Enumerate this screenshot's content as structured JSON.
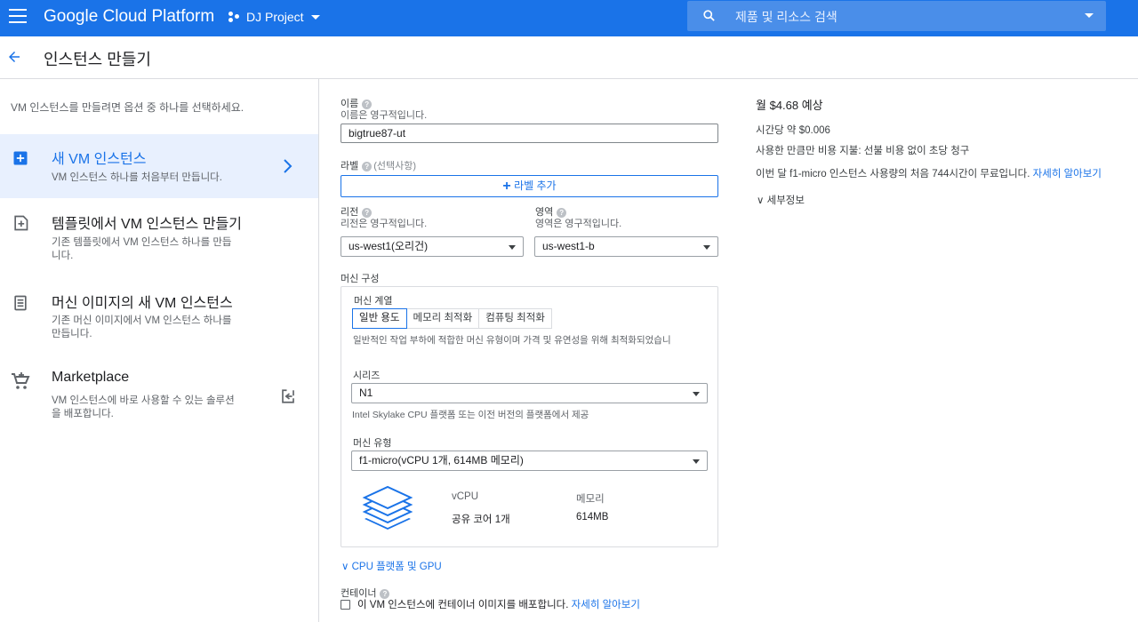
{
  "header": {
    "brand": "Google Cloud Platform",
    "project": "DJ Project",
    "search_placeholder": "제품 및 리소스 검색"
  },
  "title": "인스턴스 만들기",
  "left": {
    "intro": "VM 인스턴스를 만들려면 옵션 중 하나를 선택하세요.",
    "options": [
      {
        "title": "새 VM 인스턴스",
        "desc": "VM 인스턴스 하나를 처음부터 만듭니다.",
        "icon": "add-box-icon"
      },
      {
        "title": "템플릿에서 VM 인스턴스 만들기",
        "desc1": "기존 템플릿에서 VM 인스턴스 하나를 만듭",
        "desc2": "니다.",
        "icon": "template-icon"
      },
      {
        "title": "머신 이미지의 새 VM 인스턴스",
        "desc1": "기존 머신 이미지에서 VM 인스턴스 하나를",
        "desc2": "만듭니다.",
        "icon": "machine-image-icon"
      },
      {
        "title": "Marketplace",
        "desc1": "VM 인스턴스에 바로 사용할 수 있는 솔루션",
        "desc2": "을 배포합니다.",
        "icon": "cart-icon"
      }
    ]
  },
  "form": {
    "name_label": "이름",
    "name_sub": "이름은 영구적입니다.",
    "name_value": "bigtrue87-ut",
    "label_label": "라벨",
    "label_optional": "(선택사항)",
    "add_label_button": "라벨 추가",
    "region_label": "리전",
    "region_sub": "리전은 영구적입니다.",
    "region_value": "us-west1(오리건)",
    "zone_label": "영역",
    "zone_sub": "영역은 영구적입니다.",
    "zone_value": "us-west1-b",
    "machine_config_label": "머신 구성",
    "machine_family_label": "머신 계열",
    "tabs": [
      "일반 용도",
      "메모리 최적화",
      "컴퓨팅 최적화"
    ],
    "family_desc": "일반적인 작업 부하에 적합한 머신 유형이며 가격 및 유연성을 위해 최적화되었습니",
    "series_label": "시리즈",
    "series_value": "N1",
    "series_desc": "Intel Skylake CPU 플랫폼 또는 이전 버전의 플랫폼에서 제공",
    "machine_type_label": "머신 유형",
    "machine_type_value": "f1-micro(vCPU 1개, 614MB 메모리)",
    "vcpu_header": "vCPU",
    "vcpu_value": "공유 코어 1개",
    "memory_header": "메모리",
    "memory_value": "614MB",
    "cpu_platform_link": "CPU 플랫폼 및 GPU",
    "container_label": "컨테이너",
    "container_checkbox": "이 VM 인스턴스에 컨테이너 이미지를 배포합니다.",
    "learn_more": "자세히 알아보기"
  },
  "pricing": {
    "monthly": "월 $4.68 예상",
    "hourly": "시간당 약 $0.006",
    "sustained": "사용한 만큼만 비용 지불: 선불 비용 없이 초당 청구",
    "free_tier": "이번 달 f1-micro 인스턴스 사용량의 처음 744시간이 무료입니다.",
    "learn_more": "자세히 알아보기",
    "details": "세부정보"
  },
  "colors": {
    "accent": "#1a73e8",
    "selected_bg": "#e8f0fe"
  }
}
